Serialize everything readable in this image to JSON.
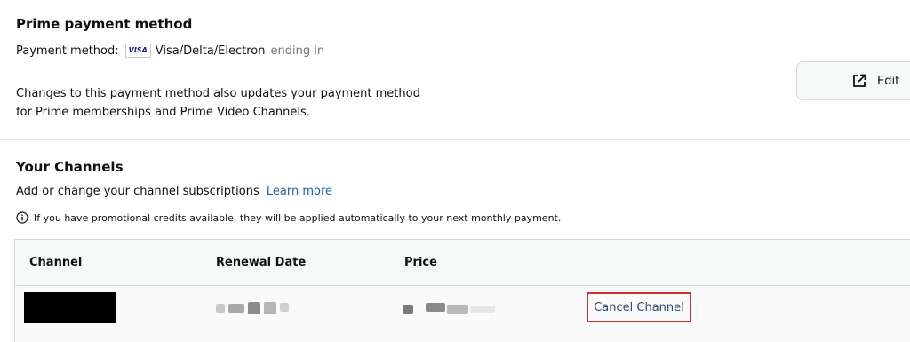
{
  "prime_payment": {
    "title": "Prime payment method",
    "payment_label": "Payment method:",
    "card_badge": "VISA",
    "card_type": "Visa/Delta/Electron",
    "ending_text": "ending in",
    "note_line1": "Changes to this payment method also updates your payment method",
    "note_line2": "for Prime memberships and Prime Video Channels.",
    "edit_label": "Edit",
    "edit_icon": "external-link-icon"
  },
  "channels": {
    "title": "Your Channels",
    "subtitle": "Add or change your channel subscriptions",
    "learn_more": "Learn more",
    "promo_icon": "info-icon",
    "promo_text": "If you have promotional credits available, they will be applied automatically to your next monthly payment.",
    "table": {
      "headers": [
        "Channel",
        "Renewal Date",
        "Price"
      ],
      "rows": [
        {
          "cancel_label": "Cancel Channel"
        }
      ]
    }
  },
  "colors": {
    "link": "#2162a1",
    "highlight_box": "#d32f2f",
    "header_bg": "#f7f8f8"
  }
}
